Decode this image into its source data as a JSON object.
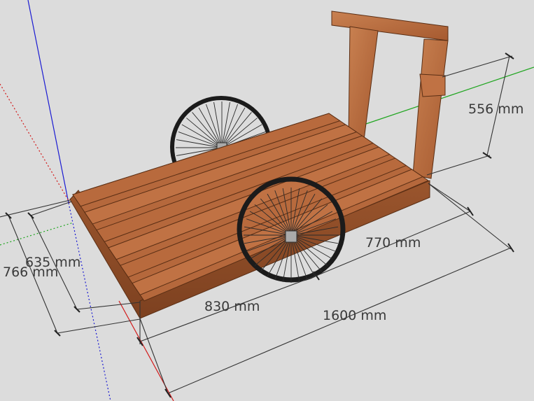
{
  "app": "SketchUp model viewport",
  "model": {
    "subject": "wooden cart with two spoked wheels",
    "colors": {
      "background": "#dcdcdc",
      "wood": "#b5683c",
      "wood_dark": "#8e4b27",
      "wood_light": "#c98151",
      "tire": "#1b1b1b",
      "axis_red": "#d21a1a",
      "axis_green": "#1fa51f",
      "axis_blue": "#1a1ad2"
    }
  },
  "dimensions": {
    "height": "556 mm",
    "inner_length": "770 mm",
    "wheel_offset": "830 mm",
    "overall_length": "1600 mm",
    "inner_width": "635 mm",
    "overall_width": "766 mm"
  }
}
